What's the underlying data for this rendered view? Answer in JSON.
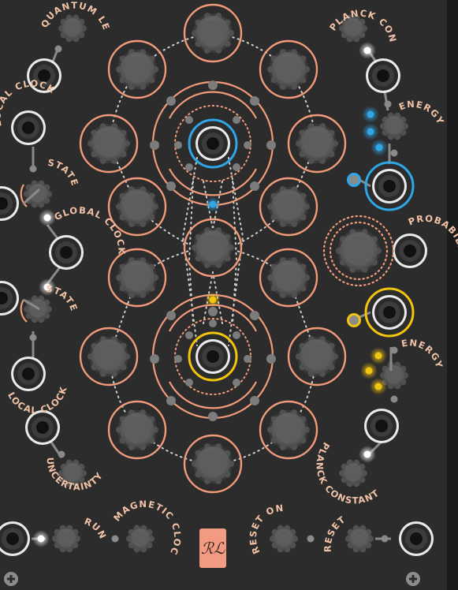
{
  "module": {
    "logo_text": "ℛℒ",
    "colors": {
      "panel": "#2c2c2c",
      "ring": "#f29b7a",
      "dot_gray": "#8a8a8a",
      "blue_accent": "#2fa7e6",
      "yellow_accent": "#f1c40f",
      "label": "#f1c2a6",
      "logo_bg": "#f39a82"
    }
  },
  "labels": {
    "left": {
      "quantum_leap": "QUANTUM LEAP",
      "local_clock_top": "LOCAL CLOCK",
      "state_top": "STATE",
      "global_clock": "GLOBAL CLOCK",
      "state_bottom": "STATE",
      "local_clock_bottom": "LOCAL CLOCK",
      "uncertainty": "UNCERTAINTY"
    },
    "right": {
      "planck_constant_top": "PLANCK CONSTANT",
      "energy_top": "ENERGY",
      "probability": "PROBABILITY",
      "energy_bottom": "ENERGY",
      "planck_constant_bottom": "PLANCK CONSTANT"
    },
    "bottom": {
      "run": "RUN",
      "magnetic_clock": "MAGNETIC CLOCK",
      "reset_on_run": "RESET ON RUN",
      "reset": "RESET"
    }
  },
  "icons": {
    "add_left": "plus-icon",
    "add_right": "plus-icon"
  }
}
